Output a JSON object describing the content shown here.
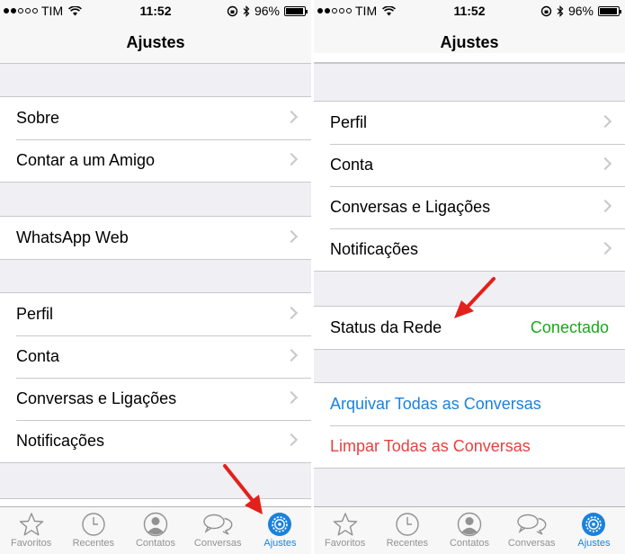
{
  "status_bar": {
    "carrier": "TIM",
    "time": "11:52",
    "battery": "96%",
    "battery_fraction": 0.96
  },
  "left": {
    "title": "Ajustes",
    "groups": [
      {
        "rows": [
          {
            "label": "Sobre"
          },
          {
            "label": "Contar a um Amigo"
          }
        ]
      },
      {
        "rows": [
          {
            "label": "WhatsApp Web"
          }
        ]
      },
      {
        "rows": [
          {
            "label": "Perfil"
          },
          {
            "label": "Conta"
          },
          {
            "label": "Conversas e Ligações"
          },
          {
            "label": "Notificações"
          }
        ]
      }
    ]
  },
  "right": {
    "title": "Ajustes",
    "groups": [
      {
        "rows": [
          {
            "label": "Perfil"
          },
          {
            "label": "Conta"
          },
          {
            "label": "Conversas e Ligações"
          },
          {
            "label": "Notificações"
          }
        ]
      },
      {
        "rows": [
          {
            "label": "Status da Rede",
            "value": "Conectado"
          }
        ]
      },
      {
        "rows": [
          {
            "label": "Arquivar Todas as Conversas"
          },
          {
            "label": "Limpar Todas as Conversas"
          }
        ]
      }
    ]
  },
  "tabs": [
    {
      "label": "Favoritos",
      "icon": "star-icon"
    },
    {
      "label": "Recentes",
      "icon": "clock-icon"
    },
    {
      "label": "Contatos",
      "icon": "person-icon"
    },
    {
      "label": "Conversas",
      "icon": "chat-bubbles-icon"
    },
    {
      "label": "Ajustes",
      "icon": "gear-icon",
      "active": true
    }
  ],
  "colors": {
    "accent": "#1a82dc",
    "destructive": "#e8403e",
    "status_ok": "#1aa81a",
    "annotation_arrow": "#e3201b"
  }
}
